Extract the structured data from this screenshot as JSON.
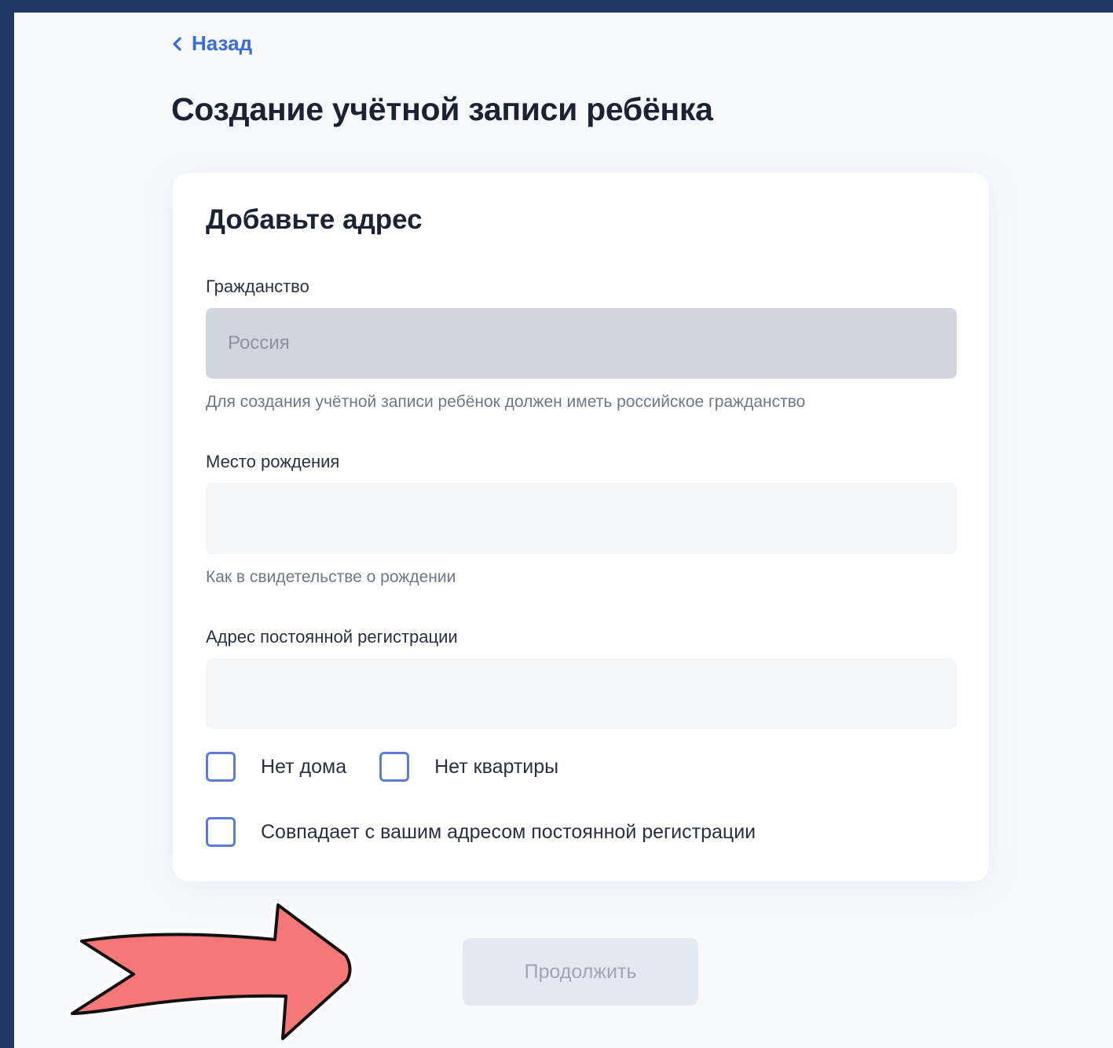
{
  "nav": {
    "back_label": "Назад"
  },
  "page": {
    "title": "Создание учётной записи ребёнка"
  },
  "card": {
    "title": "Добавьте адрес",
    "citizenship": {
      "label": "Гражданство",
      "value": "Россия",
      "hint": "Для создания учётной записи ребёнок должен иметь российское гражданство"
    },
    "birthplace": {
      "label": "Место рождения",
      "value": "",
      "hint": "Как в свидетельстве о рождении"
    },
    "registration": {
      "label": "Адрес постоянной регистрации",
      "value": ""
    },
    "checkboxes": {
      "no_house": "Нет дома",
      "no_apartment": "Нет квартиры",
      "same_address": "Совпадает с вашим адресом постоянной регистрации"
    }
  },
  "actions": {
    "continue_label": "Продолжить"
  },
  "colors": {
    "frame": "#1f3765",
    "accent": "#3a6cd6",
    "arrow_fill": "#f57777"
  }
}
